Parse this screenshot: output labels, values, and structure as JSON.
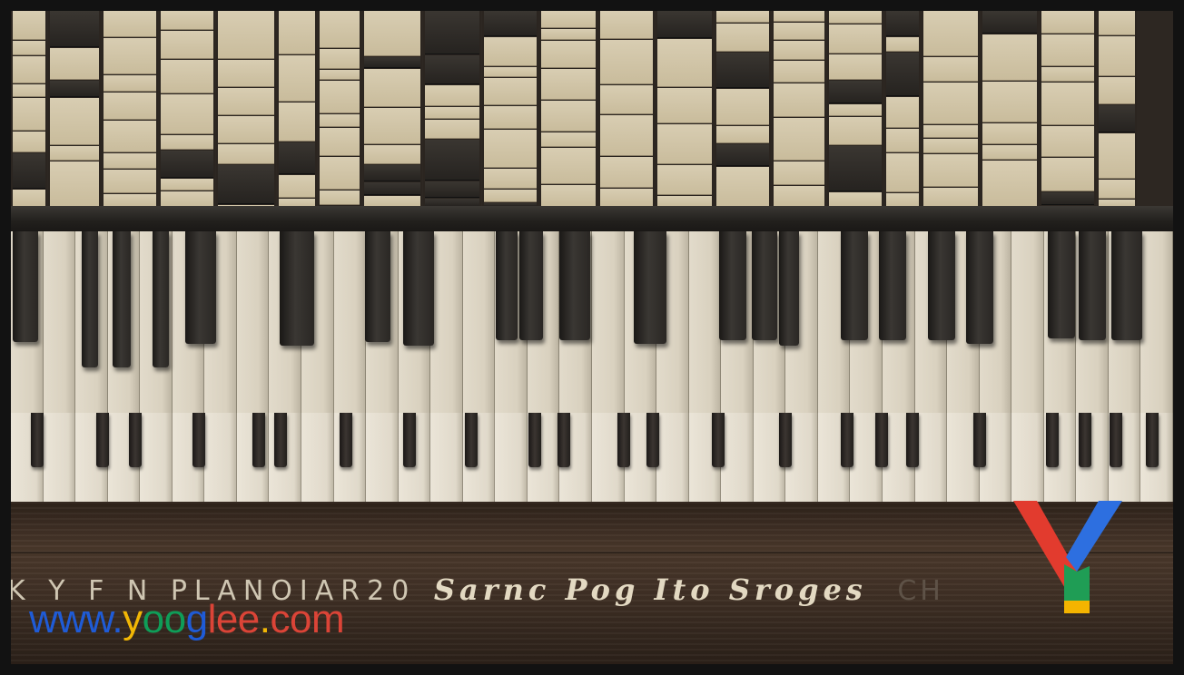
{
  "image": {
    "subject": "piano-keyboard-illustration",
    "palette": {
      "wood": "#3e2f24",
      "ivory": "#e2dbcb",
      "ebony": "#1f1c19",
      "blocks": "#d2c6aa"
    }
  },
  "engraving": {
    "left": "K Y F N PLANOIAR20",
    "script": "Sarnc Pog Ito Sroges",
    "right": "CH"
  },
  "watermark": {
    "url_parts": [
      {
        "text": "www.",
        "color": "#1f5bd6"
      },
      {
        "text": "y",
        "color": "#f2b705"
      },
      {
        "text": "oo",
        "color": "#0f9d58"
      },
      {
        "text": "g",
        "color": "#1f5bd6"
      },
      {
        "text": "lee",
        "color": "#db4437"
      },
      {
        "text": ".",
        "color": "#f2b705"
      },
      {
        "text": "com",
        "color": "#db4437"
      }
    ],
    "logo": {
      "icon": "yooglee-y-logo",
      "colors": [
        "#e23b2e",
        "#2d6fe0",
        "#1f9d55",
        "#f4b400"
      ]
    }
  }
}
